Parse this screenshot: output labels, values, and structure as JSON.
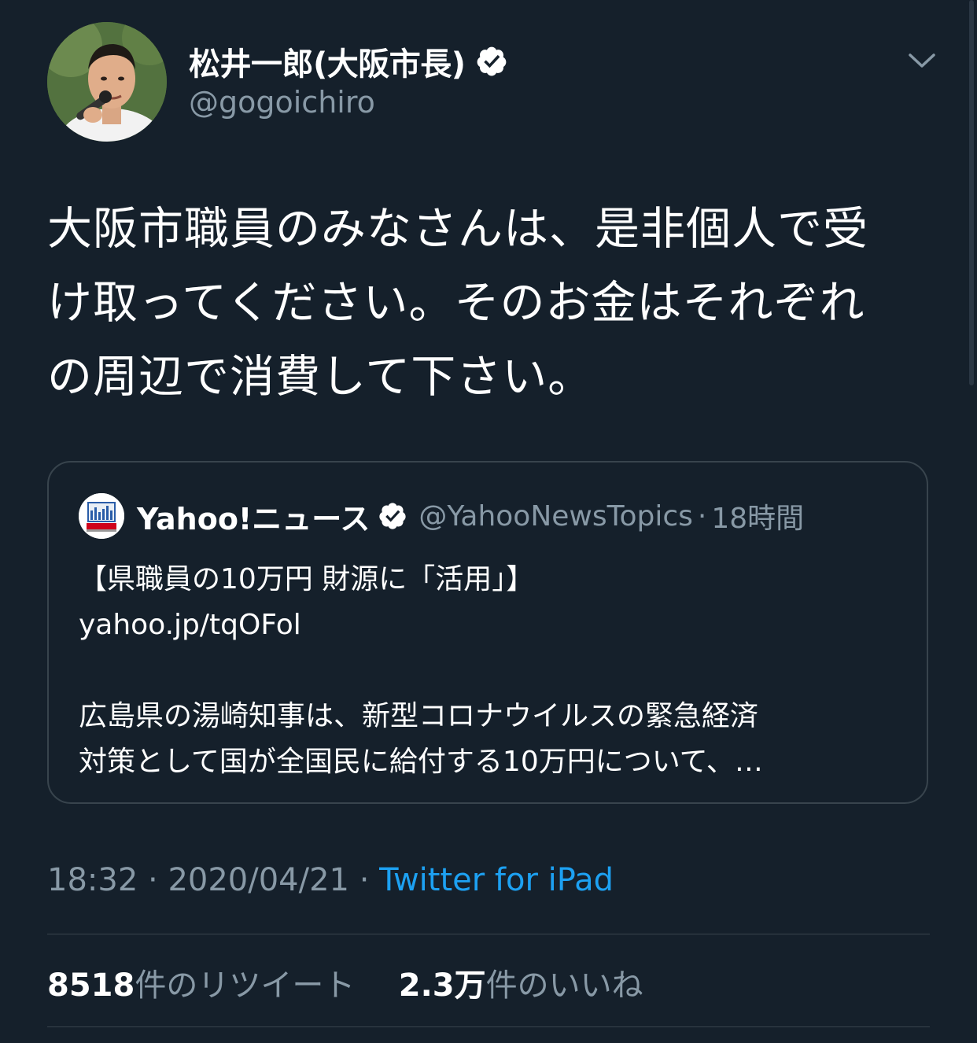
{
  "tweet": {
    "author": {
      "display_name": "松井一郎(大阪市長)",
      "handle": "@gogoichiro",
      "verified": true,
      "avatar_icon": "avatar-photo-icon"
    },
    "text_lines": [
      "大阪市職員のみなさんは、是非個人で受",
      "け取ってください。そのお金はそれぞれ",
      "の周辺で消費して下さい。"
    ],
    "quote": {
      "display_name": "Yahoo!ニュース",
      "handle": "@YahooNewsTopics",
      "separator": "·",
      "time": "18時間",
      "verified": true,
      "avatar_icon": "yahoo-news-logo-icon",
      "body_lines": [
        "【県職員の10万円 財源に「活用」】",
        "yahoo.jp/tqOFol",
        "",
        "広島県の湯崎知事は、新型コロナウイルスの緊急経済",
        "対策として国が全国民に給付する10万円について、…"
      ]
    },
    "meta": {
      "time": "18:32",
      "separator1": "·",
      "date": "2020/04/21",
      "separator2": "·",
      "source": "Twitter for iPad"
    },
    "stats": {
      "retweets_count": "8518",
      "retweets_label": "件のリツイート",
      "likes_count": "2.3万",
      "likes_label": "件のいいね"
    }
  },
  "colors": {
    "background": "#15202b",
    "text_primary": "#ffffff",
    "text_secondary": "#8899a6",
    "accent": "#1da1f2",
    "border": "#38444d"
  }
}
